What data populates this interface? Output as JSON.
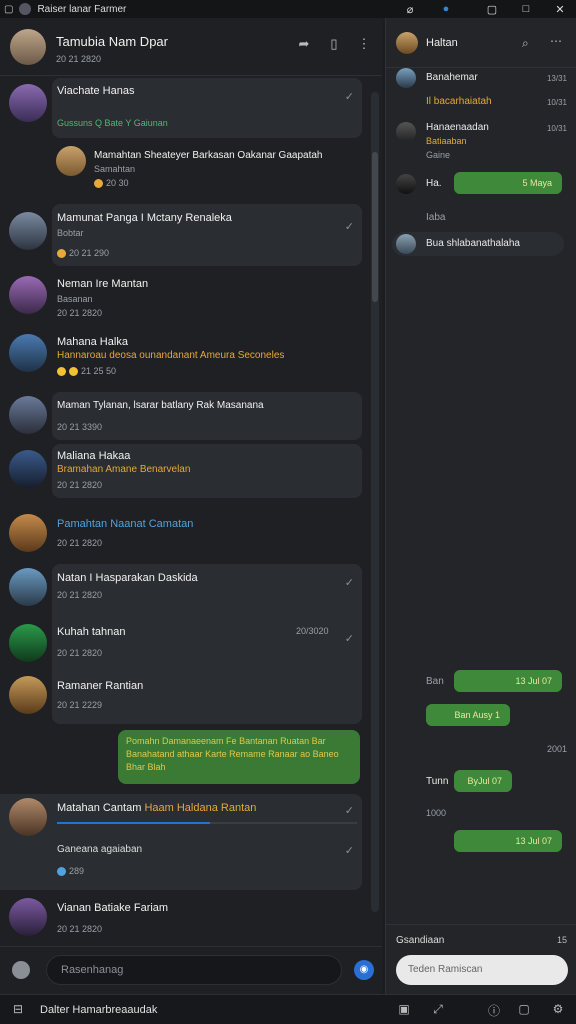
{
  "window": {
    "title": "Raiser lanar Farmer"
  },
  "chat": {
    "title": "Tamubia Nam Dpar",
    "meta": "20 21 2820",
    "colors": {
      "accent": "#3b7a35",
      "brand": "#2a6fd6",
      "orange": "#e6a93a"
    }
  },
  "messages": [
    {
      "name": "Viachate Hanas",
      "toolbar": "Gussuns  Q  Bate  Y  Gaiunan",
      "time": ""
    },
    {
      "name": "Mamahtan Sheateyer Barkasan Oakanar Gaapatah",
      "sub": "Samahtan",
      "time": "20 30"
    },
    {
      "name": "Mamunat Panga I Mctany Renaleka",
      "sub": "Bobtar",
      "time": "20 21 290"
    },
    {
      "name": "Neman Ire Mantan",
      "sub": "Basanan",
      "time": "20 21 2820"
    },
    {
      "name": "Mahana Halka",
      "sub": "Hannaroau deosa ounandanant Ameura Seconeles",
      "time": "21 25 50"
    },
    {
      "name": "Maman Tylanan, lsarar batlany Rak Masanana",
      "time": "20 21 3390"
    },
    {
      "name": "Maliana Hakaa",
      "sub": "Bramahan Amane Benarvelan",
      "time": "20 21 2820"
    },
    {
      "name": "Pamahtan Naanat Camatan",
      "time": "20 21 2820"
    },
    {
      "name": "Natan I Hasparakan Daskida",
      "time": "20 21 2820"
    },
    {
      "name": "Kuhah tahnan",
      "time": "20 21 2820",
      "right": "20/3020"
    },
    {
      "name": "Ramaner Rantian",
      "time": "20 21 2229"
    },
    {
      "outgoing": "Pomahn Damanaeenam Fe Bantanan Ruatan Bar Banahatand athaar Karte Remame Ranaar ao Baneo Bhar Blah"
    },
    {
      "name": "Matahan Cantam",
      "highlight": "Haam Haldana Rantan",
      "reply": "Ganeana agaiaban",
      "time": "289"
    },
    {
      "name": "Vianan Batiake Fariam",
      "time": "20 21 2820"
    }
  ],
  "composer": {
    "placeholder": "Rasenhanag"
  },
  "right": {
    "title": "Haltan",
    "items": [
      {
        "name": "Banahemar",
        "time": "13/31"
      },
      {
        "name": "Il bacarhaiatah",
        "time": "10/31"
      },
      {
        "name": "Hanaenaadan",
        "sub": "Batiaaban",
        "sub2": "Gaine",
        "time": "10/31"
      },
      {
        "name": "Ha.",
        "bubble": "5 Maya"
      },
      {
        "name": "Iaba"
      },
      {
        "name": "Bua shlabanathalaha"
      }
    ],
    "bubbles": [
      {
        "label": "Ban",
        "text": "13 Jul 07"
      },
      {
        "text": "Ban Ausy 1"
      },
      {
        "label": "2001"
      },
      {
        "label": "Tunn",
        "text": "ByJul 07"
      },
      {
        "label": "1000"
      },
      {
        "text": "13 Jul 07"
      }
    ],
    "footer": {
      "label": "Gsandiaan",
      "badge": "15",
      "input_placeholder": "Teden Ramiscan"
    }
  },
  "status": {
    "label": "Dalter Hamarbreaaudak"
  }
}
